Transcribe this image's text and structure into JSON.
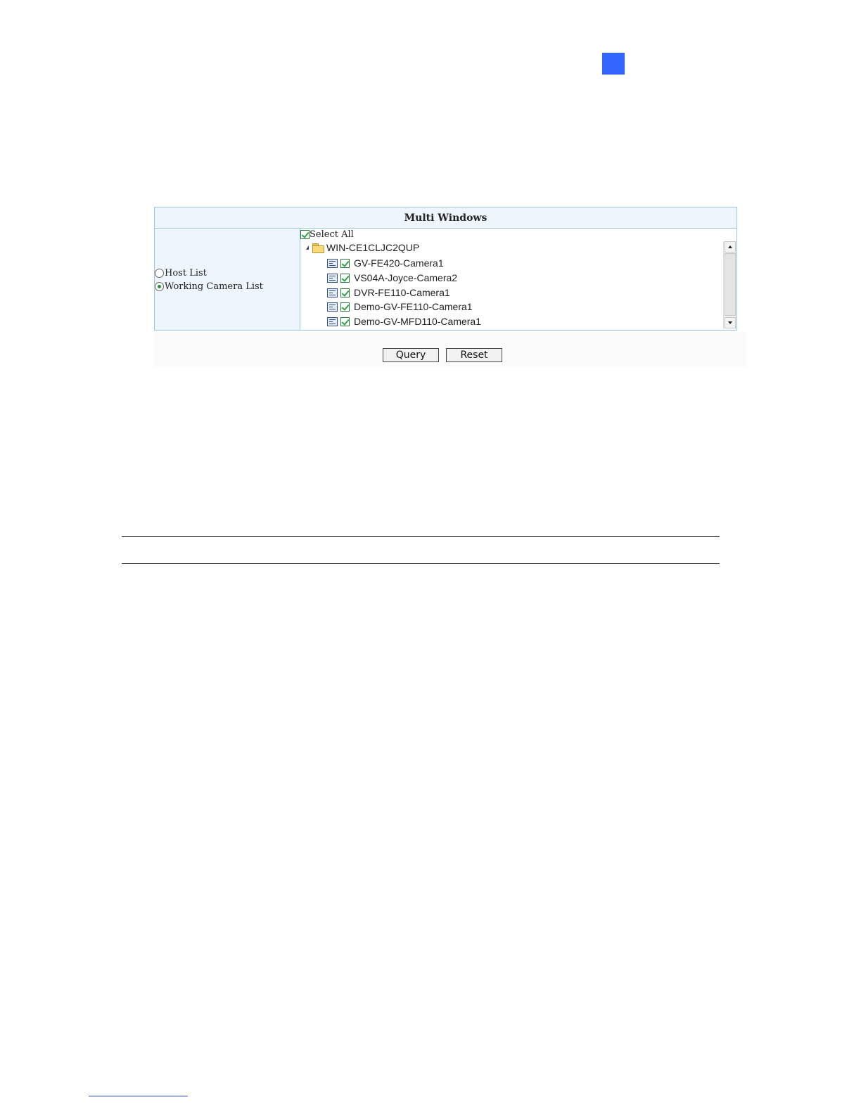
{
  "colors": {
    "chapter_marker": "#3366ff",
    "panel_border": "#99c6e6",
    "panel_bg": "#eef5fd",
    "check": "#2fa34a"
  },
  "panel": {
    "title": "Multi Windows",
    "list_options": [
      {
        "label": "Host List",
        "selected": false
      },
      {
        "label": "Working Camera List",
        "selected": true
      }
    ],
    "select_all": {
      "label": "Select All",
      "checked": true
    },
    "tree": {
      "root": {
        "label": "WIN-CE1CLJC2QUP",
        "icon": "folder-icon",
        "expanded": true
      },
      "items": [
        {
          "label": "GV-FE420-Camera1",
          "icon": "camera-list-icon",
          "checked": true
        },
        {
          "label": "VS04A-Joyce-Camera2",
          "icon": "camera-list-icon",
          "checked": true
        },
        {
          "label": "DVR-FE110-Camera1",
          "icon": "camera-list-icon",
          "checked": true
        },
        {
          "label": "Demo-GV-FE110-Camera1",
          "icon": "camera-list-icon",
          "checked": true
        },
        {
          "label": "Demo-GV-MFD110-Camera1",
          "icon": "camera-list-icon",
          "checked": true
        }
      ]
    }
  },
  "buttons": {
    "query": "Query",
    "reset": "Reset"
  }
}
